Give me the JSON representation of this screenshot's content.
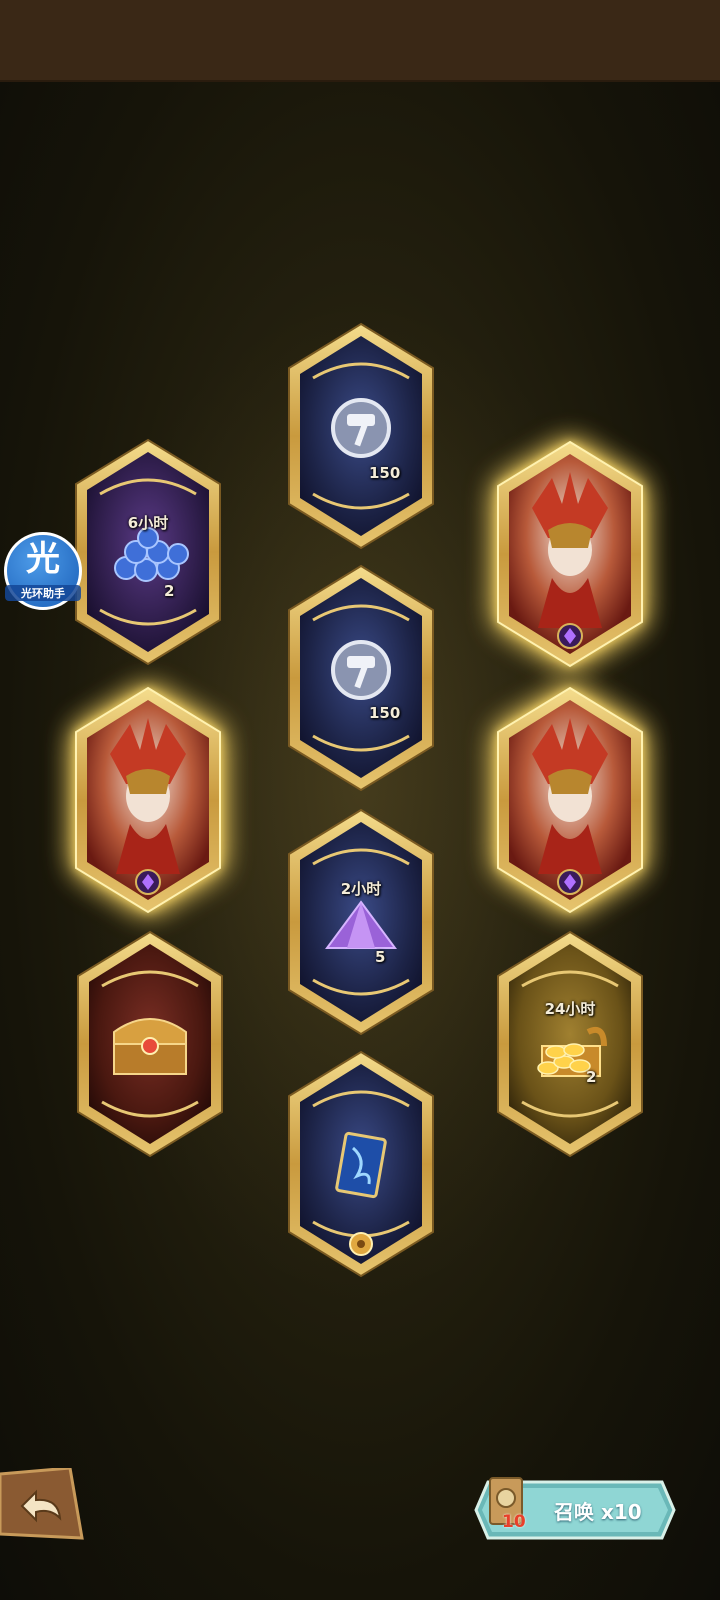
{
  "assistant": {
    "glyph": "光",
    "label": "光环助手"
  },
  "rewards": [
    {
      "id": "hammer-top",
      "label": "",
      "qty": "150"
    },
    {
      "id": "crystal-beans",
      "label": "6小时",
      "qty": "2"
    },
    {
      "id": "hero-portrait-right-top",
      "label": "",
      "qty": ""
    },
    {
      "id": "hammer-mid",
      "label": "",
      "qty": "150"
    },
    {
      "id": "hero-portrait-left",
      "label": "",
      "qty": ""
    },
    {
      "id": "hero-portrait-right-mid",
      "label": "",
      "qty": ""
    },
    {
      "id": "dust",
      "label": "2小时",
      "qty": "5"
    },
    {
      "id": "chest",
      "label": "",
      "qty": ""
    },
    {
      "id": "gold",
      "label": "24小时",
      "qty": "2"
    },
    {
      "id": "scroll-card",
      "label": "",
      "qty": ""
    }
  ],
  "summon_button": {
    "label": "召唤 x10",
    "badge": "10"
  },
  "colors": {
    "frame_gold": "#d8b45a",
    "inner_blue": "#1e2448",
    "glow": "#ffd25a",
    "summon_teal": "#8fd6d4"
  }
}
